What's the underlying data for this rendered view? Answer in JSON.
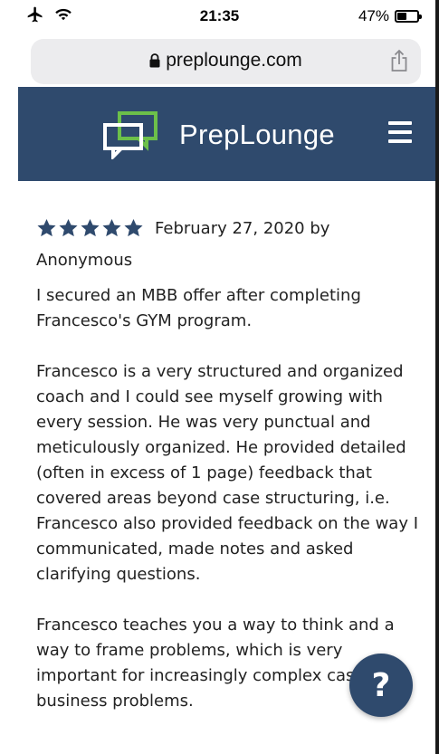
{
  "status_bar": {
    "time": "21:35",
    "battery_percent": "47%",
    "battery_level": 0.47,
    "icons": [
      "airplane-icon",
      "wifi-icon",
      "battery-icon"
    ]
  },
  "browser": {
    "url": "preplounge.com",
    "icons": [
      "lock-icon",
      "share-icon"
    ]
  },
  "header": {
    "logo_text": "PrepLounge",
    "brand_color": "#2f4a6d",
    "accent_color": "#6cc04a",
    "icons": [
      "preplounge-logo-icon",
      "hamburger-menu-icon"
    ]
  },
  "review": {
    "rating": 5,
    "star_color": "#2f4a6d",
    "date_line": "February 27, 2020 by",
    "author": "Anonymous",
    "paragraphs": [
      "I secured an MBB offer after completing Francesco's GYM program.",
      "Francesco is a very structured and organized coach and I could see myself growing with every session. He was very punctual and meticulously organized. He provided detailed (often in excess of 1 page) feedback that covered areas beyond case structuring, i.e. Francesco also provided feedback on the way I communicated, made notes and asked clarifying questions.",
      "Francesco teaches you a way to think and a way to frame problems, which is very important for increasingly complex cases and business problems."
    ]
  },
  "help_button": {
    "label": "?"
  }
}
